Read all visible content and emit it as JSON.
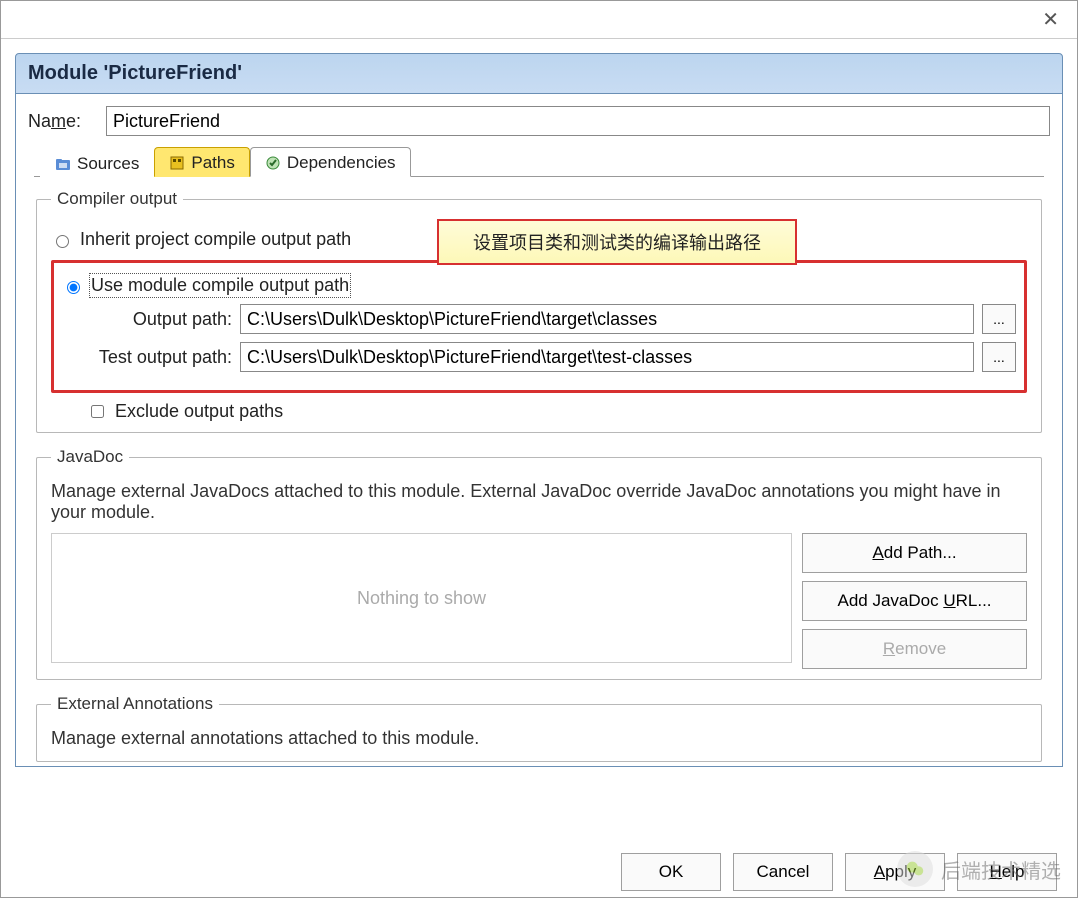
{
  "dialog": {
    "title": "Module 'PictureFriend'",
    "close_symbol": "✕"
  },
  "name": {
    "label": "Name:",
    "value": "PictureFriend"
  },
  "tabs": {
    "sources": "Sources",
    "paths": "Paths",
    "dependencies": "Dependencies"
  },
  "compiler": {
    "legend": "Compiler output",
    "inherit_label": "Inherit project compile output path",
    "use_module_label": "Use module compile output path",
    "callout": "设置项目类和测试类的编译输出路径",
    "output_path_label": "Output path:",
    "output_path_value": "C:\\Users\\Dulk\\Desktop\\PictureFriend\\target\\classes",
    "test_output_path_label": "Test output path:",
    "test_output_path_value": "C:\\Users\\Dulk\\Desktop\\PictureFriend\\target\\test-classes",
    "exclude_label": "Exclude output paths",
    "browse_label": "..."
  },
  "javadoc": {
    "legend": "JavaDoc",
    "desc": "Manage external JavaDocs attached to this module. External JavaDoc override JavaDoc annotations you might have in your module.",
    "empty": "Nothing to show",
    "add_path": "Add Path...",
    "add_url": "Add JavaDoc URL...",
    "remove": "Remove"
  },
  "external": {
    "legend": "External Annotations",
    "desc": "Manage external annotations attached to this module."
  },
  "buttons": {
    "ok": "OK",
    "cancel": "Cancel",
    "apply": "Apply",
    "help": "Help"
  },
  "watermark": {
    "text": "后端技术精选"
  }
}
